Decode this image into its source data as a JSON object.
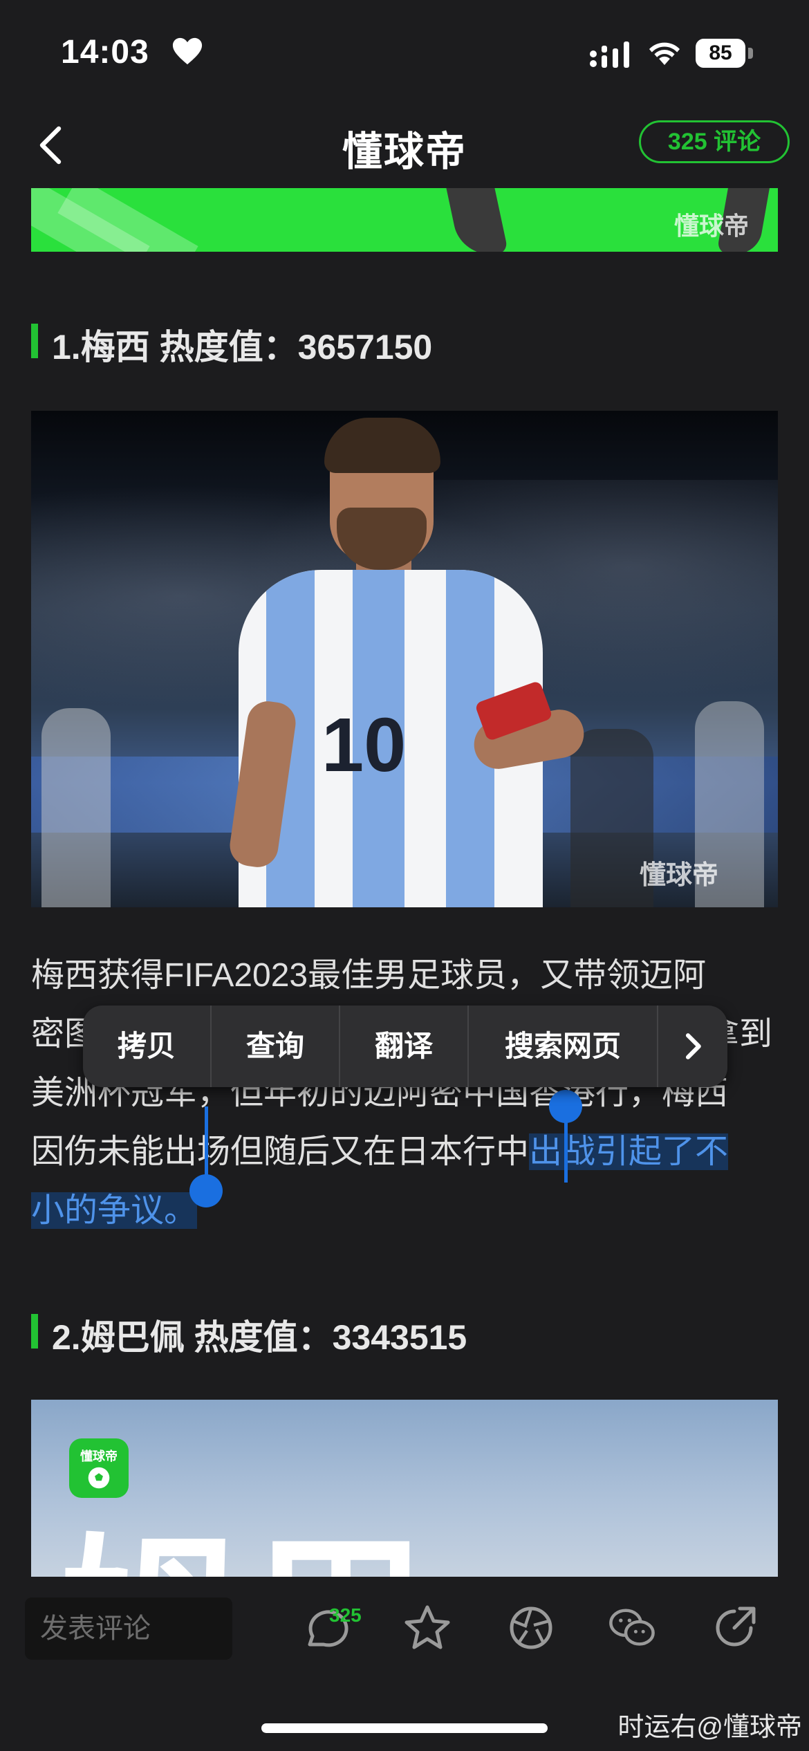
{
  "status_bar": {
    "time": "14:03",
    "battery": "85"
  },
  "nav": {
    "logo": "懂球帝",
    "comment_button": "325 评论"
  },
  "banner": {
    "watermark": "懂球帝"
  },
  "section1": {
    "title": "1.梅西 热度值：3657150"
  },
  "photo1": {
    "jersey_number": "10",
    "watermark": "懂球帝"
  },
  "paragraph": {
    "line1": "梅西获得FIFA2023最佳男足球员，又带领迈阿",
    "line2_start": "密图",
    "line2_end": "拿到",
    "line3": "美洲杯冠军，但年初的迈阿密中国香港行，梅西",
    "line4_plain": "因伤未能出场但随后又在日本行中",
    "line4_selected": "出战引起了不",
    "line5_selected": "小的争议。"
  },
  "context_menu": {
    "items": [
      "拷贝",
      "查询",
      "翻译",
      "搜索网页"
    ],
    "more_icon": "chevron-right-icon"
  },
  "section2": {
    "title": "2.姆巴佩 热度值：3343515"
  },
  "photo2": {
    "app_logo": "懂球帝",
    "headline_text": "姆巴"
  },
  "toolbar": {
    "comment_placeholder": "发表评论",
    "comment_count": "325",
    "icons": [
      "comment-icon",
      "star-icon",
      "aperture-icon",
      "wechat-icon",
      "share-icon"
    ]
  },
  "credit": "时运右@懂球帝",
  "colors": {
    "accent": "#22c233",
    "selection": "#1a6fe0",
    "background": "#1c1c1e"
  }
}
